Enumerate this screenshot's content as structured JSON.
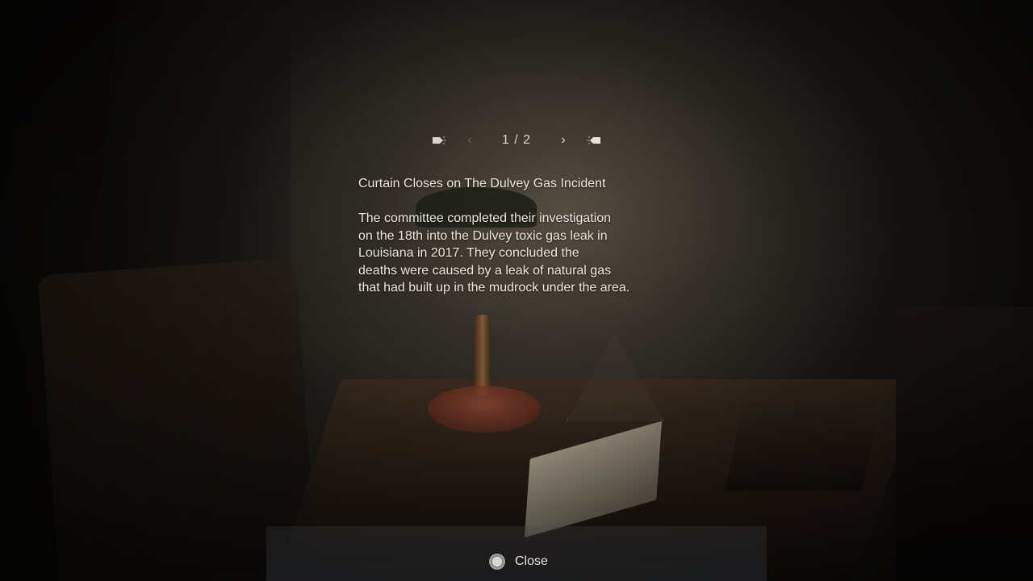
{
  "pager": {
    "prev_shoulder_icon": "l1-button-icon",
    "prev_arrow": "‹",
    "page_indicator": "1 / 2",
    "next_arrow": "›",
    "next_shoulder_icon": "r1-button-icon",
    "current_page": 1,
    "total_pages": 2
  },
  "document": {
    "title": "Curtain Closes on The Dulvey Gas Incident",
    "body_lines": [
      "The committee completed their investigation",
      "on the 18th into the Dulvey toxic gas leak in",
      "Louisiana in 2017. They concluded the",
      "deaths were caused by a leak of natural gas",
      "that had built up in the mudrock under the area."
    ]
  },
  "footer": {
    "close_icon": "circle-button-icon",
    "close_label": "Close"
  },
  "colors": {
    "text": "#ece8de",
    "disabled_arrow": "#6f6c66",
    "footer_bar": "#2d3238"
  }
}
